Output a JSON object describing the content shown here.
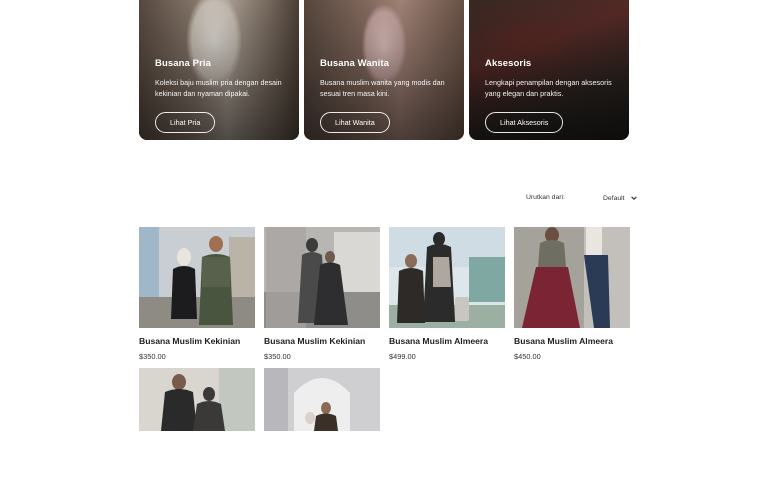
{
  "categories": [
    {
      "title": "Busana Pria",
      "desc": "Koleksi baju muslim pria dengan desain kekinian dan nyaman dipakai.",
      "button": "Lihat Pria"
    },
    {
      "title": "Busana Wanita",
      "desc": "Busana muslim wanita yang modis dan sesuai tren masa kini.",
      "button": "Lihat Wanita"
    },
    {
      "title": "Aksesoris",
      "desc": "Lengkapi penampilan dengan aksesoris yang elegan dan praktis.",
      "button": "Lihat Aksesoris"
    }
  ],
  "sort": {
    "label": "Urutkan dari:",
    "selected": "Default",
    "icon": "chevron-down-icon"
  },
  "products": [
    {
      "name": "Busana Muslim Kekinian",
      "price": "$350.00"
    },
    {
      "name": "Busana Muslim Kekinian",
      "price": "$350.00"
    },
    {
      "name": "Busana Muslim Almeera",
      "price": "$499.00"
    },
    {
      "name": "Busana Muslim Almeera",
      "price": "$450.00"
    },
    {
      "name": "",
      "price": ""
    },
    {
      "name": "",
      "price": ""
    }
  ]
}
